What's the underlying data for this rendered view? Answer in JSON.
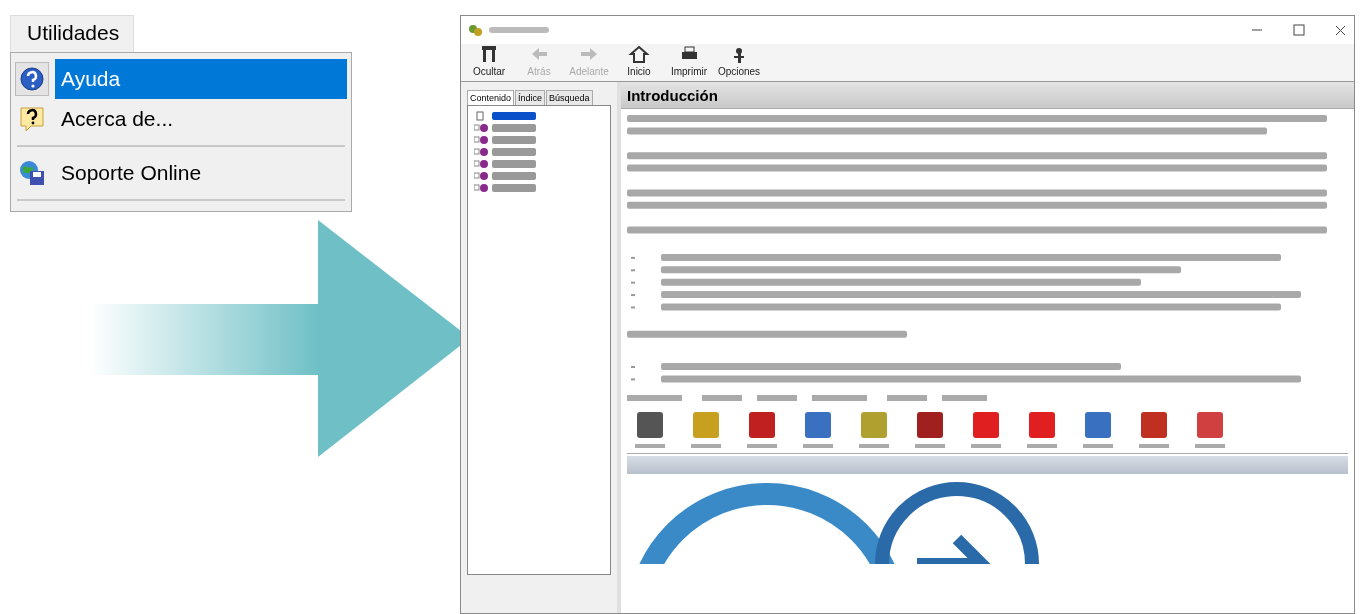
{
  "menu": {
    "title": "Utilidades",
    "items": [
      {
        "kind": "item",
        "label": "Ayuda",
        "selected": true
      },
      {
        "kind": "item",
        "label": "Acerca de...",
        "selected": false
      },
      {
        "kind": "separator"
      },
      {
        "kind": "item",
        "label": "Soporte Online",
        "selected": false
      },
      {
        "kind": "separator"
      }
    ]
  },
  "help_window": {
    "toolbar": [
      {
        "label": "Ocultar",
        "disabled": false
      },
      {
        "label": "Atrás",
        "disabled": true
      },
      {
        "label": "Adelante",
        "disabled": true
      },
      {
        "label": "Inicio",
        "disabled": false
      },
      {
        "label": "Imprimir",
        "disabled": false
      },
      {
        "label": "Opciones",
        "disabled": false
      }
    ],
    "tabs": [
      {
        "label": "Contenido",
        "selected": true
      },
      {
        "label": "Índice",
        "selected": false
      },
      {
        "label": "Búsqueda",
        "selected": false
      }
    ],
    "tree": [
      {
        "selected": true
      },
      {
        "selected": false
      },
      {
        "selected": false
      },
      {
        "selected": false
      },
      {
        "selected": false
      },
      {
        "selected": false
      },
      {
        "selected": false
      }
    ],
    "heading": "Introducción"
  }
}
